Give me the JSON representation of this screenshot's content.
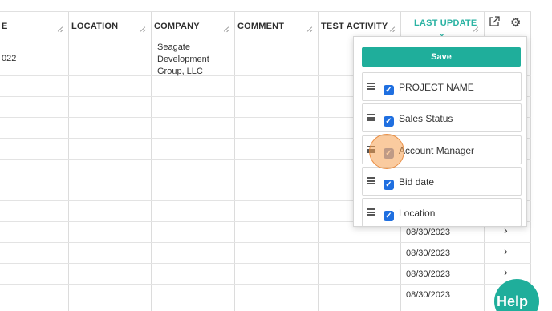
{
  "header": {
    "col_partial": "E",
    "location": "LOCATION",
    "company": "COMPANY",
    "comment": "COMMENT",
    "test_activity": "TEST ACTIVITY",
    "last_update": "LAST UPDATE"
  },
  "row1": {
    "partial_date": "022",
    "company": "Seagate Development Group, LLC"
  },
  "dates": [
    "08/30/2023",
    "08/30/2023",
    "08/30/2023",
    "08/30/2023"
  ],
  "panel": {
    "save_label": "Save",
    "items": [
      {
        "label": "PROJECT NAME",
        "checked": true
      },
      {
        "label": "Sales Status",
        "checked": true
      },
      {
        "label": "Account Manager",
        "checked": true
      },
      {
        "label": "Bid date",
        "checked": true
      },
      {
        "label": "Location",
        "checked": true
      }
    ]
  },
  "icons": {
    "external": "external-link-icon",
    "settings": "gear-icon",
    "sort": "chevron-down-icon"
  },
  "help_label": "Help",
  "colors": {
    "accent": "#1fae9b",
    "checkbox": "#1f6fe0"
  }
}
